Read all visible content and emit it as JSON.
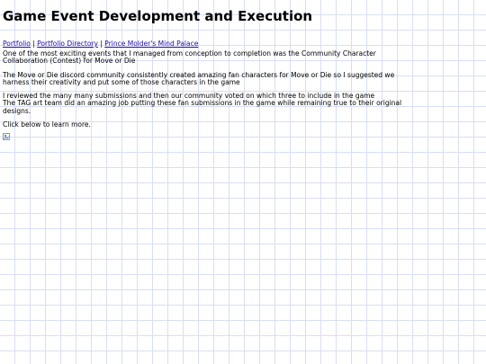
{
  "page": {
    "title": "Game Event Development and Execution",
    "nav": {
      "link_portfolio": "Portfolio",
      "sep1": "|",
      "link_directory": "Portfolio Directory",
      "sep2": "|",
      "link_palace": "Prince Molder's Mind Palace"
    },
    "paragraphs": [
      "One of the most exciting events that I managed from conception to completion was the Community Character Collaboration (Contest) for Move or Die",
      "The Move or Die discord community consistently created amazing fan characters for Move or Die so I suggested we harness their creativity and put some of those characters in the game",
      "I reviewed the many many submissions and then our community voted on which three to include in the game",
      "The TAG art team did an amazing job putting these fan submissions in the game while remaining true to their original designs.",
      "Click below to learn more."
    ],
    "image": {
      "icon": "broken-image-icon"
    }
  },
  "colors": {
    "grid_line": "#d7dff3",
    "link": "#1a0dab",
    "text": "#000000",
    "background": "#ffffff"
  }
}
